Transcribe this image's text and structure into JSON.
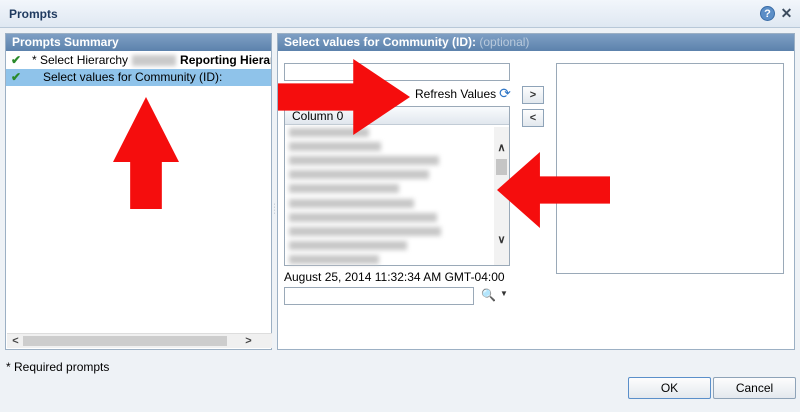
{
  "window": {
    "title": "Prompts",
    "help_icon": "question-icon",
    "close_icon": "close-icon"
  },
  "summary_panel": {
    "header": "Prompts Summary",
    "items": [
      {
        "required_marker": "* Select Hierarchy",
        "bold_text": "Reporting Hierarchy",
        "status_icon": "check-icon",
        "selected": false
      },
      {
        "label": "Select values for Community (ID):",
        "status_icon": "check-icon",
        "selected": true
      }
    ]
  },
  "values_panel": {
    "header": "Select values for Community (ID):",
    "optional_label": "(optional)",
    "search_value": "",
    "refresh_label": "Refresh Values",
    "column_header": "Column 0",
    "add_button": ">",
    "remove_button": "<",
    "timestamp": "August 25, 2014 11:32:34 AM GMT-04:00",
    "search_icon": "binoculars-icon"
  },
  "footer": {
    "required_note": "* Required prompts",
    "ok_label": "OK",
    "cancel_label": "Cancel"
  },
  "colors": {
    "panel_header": "#6a8db5",
    "selection": "#8fc3ea",
    "annotation_arrow": "#f50d0d"
  }
}
